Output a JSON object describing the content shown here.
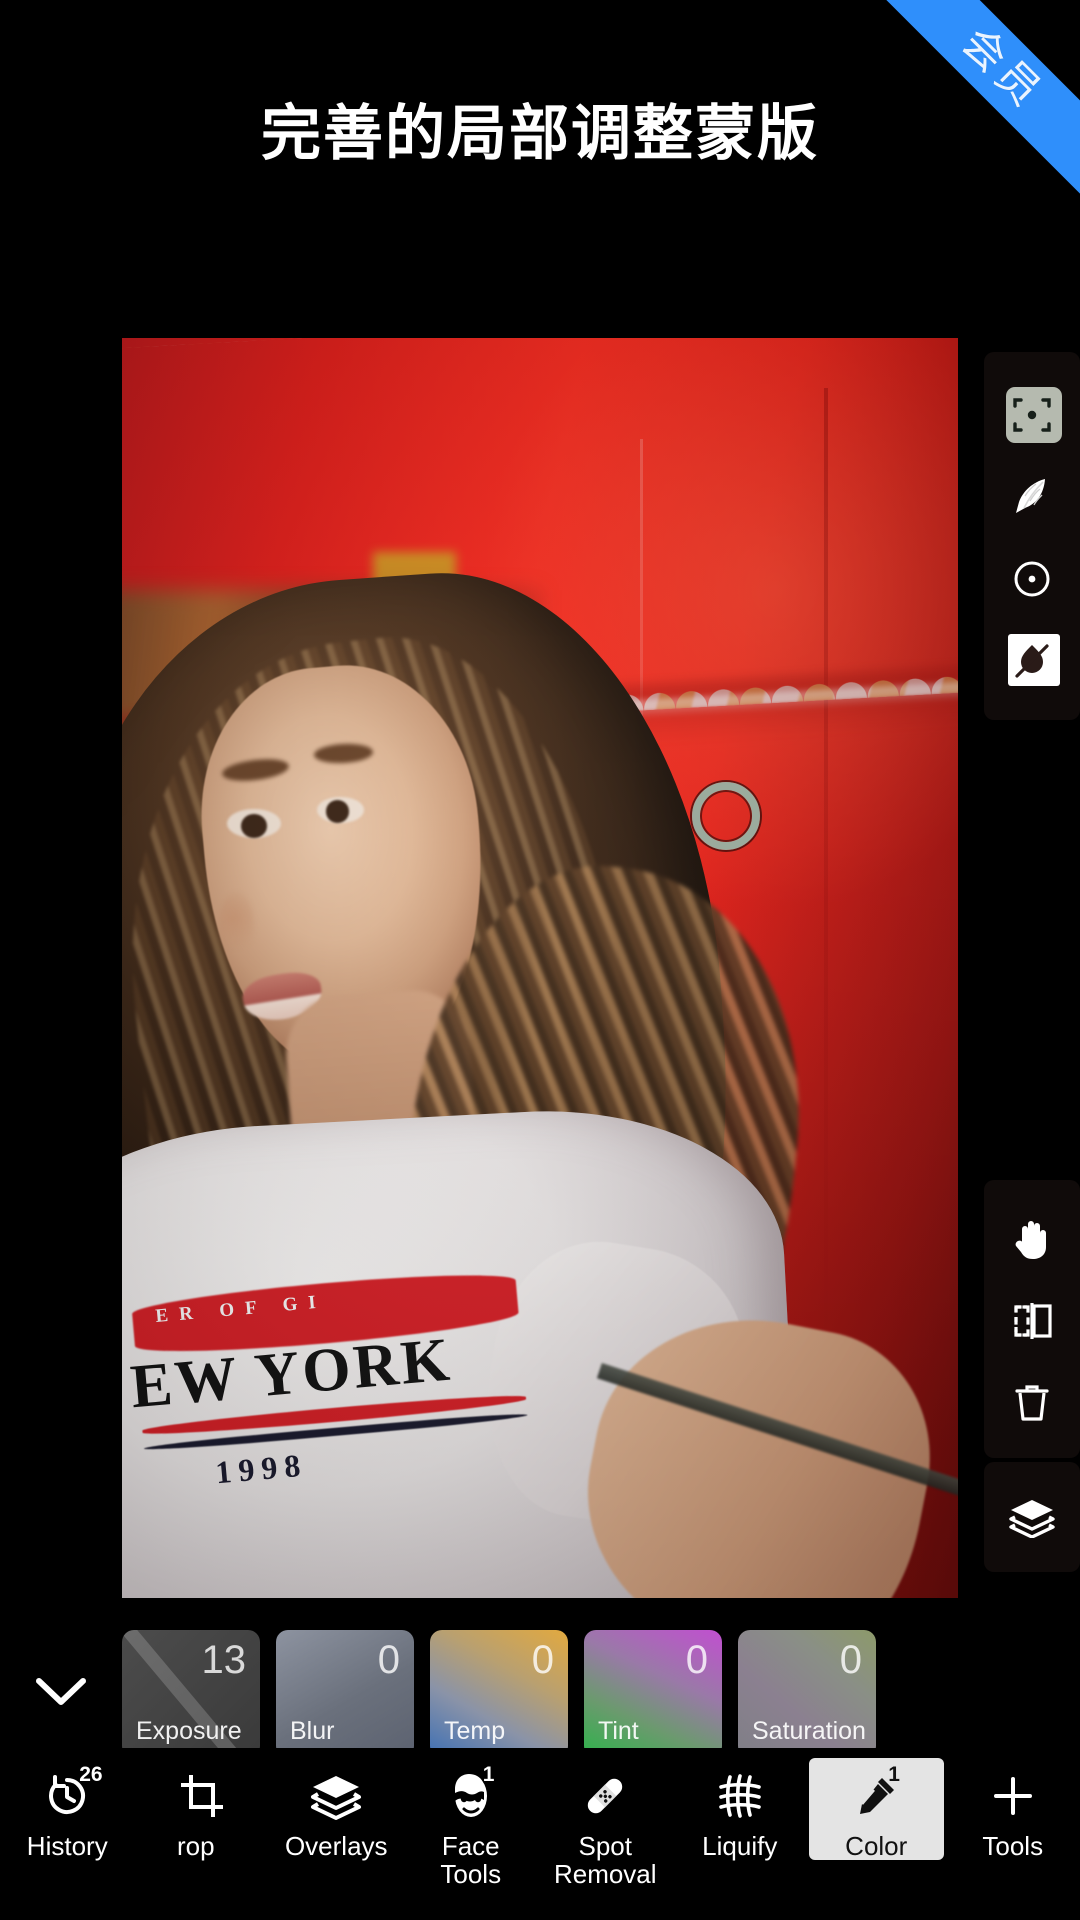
{
  "ribbon": {
    "label": "会员"
  },
  "headline": {
    "title": "完善的局部调整蒙版"
  },
  "photo": {
    "tee_line_small": "ER OF GI",
    "tee_line_big": "EW YORK",
    "tee_year": "1998"
  },
  "marker": {
    "name": "selective-adjust-point",
    "color": "#9bab9d"
  },
  "panels": {
    "top": {
      "items": [
        {
          "icon": "selective-target-icon",
          "label": "Selective",
          "selected": true
        },
        {
          "icon": "feather-icon",
          "label": "Feather",
          "selected": false
        },
        {
          "icon": "brush-size-icon",
          "label": "Size",
          "selected": false
        },
        {
          "icon": "invert-mask-icon",
          "label": "Invert",
          "selected": true
        }
      ]
    },
    "mid": {
      "items": [
        {
          "icon": "hand-pan-icon",
          "label": "Pan",
          "selected": false
        },
        {
          "icon": "flip-mask-icon",
          "label": "Flip",
          "selected": false
        },
        {
          "icon": "trash-icon",
          "label": "Delete",
          "selected": false
        }
      ]
    },
    "low": {
      "items": [
        {
          "icon": "layers-icon",
          "label": "Layers",
          "selected": false
        }
      ]
    }
  },
  "adjustments": {
    "collapse_icon": "chevron-down-icon",
    "tiles": [
      {
        "label": "Exposure",
        "value": "13",
        "key": "exposure"
      },
      {
        "label": "Blur",
        "value": "0",
        "key": "blur"
      },
      {
        "label": "Temp",
        "value": "0",
        "key": "temp"
      },
      {
        "label": "Tint",
        "value": "0",
        "key": "tint"
      },
      {
        "label": "Saturation",
        "value": "0",
        "key": "saturation"
      }
    ]
  },
  "bottom_nav": {
    "items": [
      {
        "label": "History",
        "icon": "history-icon",
        "badge": "26",
        "selected": false,
        "clipped": false
      },
      {
        "label": "rop",
        "icon": "crop-icon",
        "badge": "",
        "selected": false,
        "clipped": true
      },
      {
        "label": "Overlays",
        "icon": "overlays-icon",
        "badge": "",
        "selected": false,
        "clipped": false
      },
      {
        "label": "Face\nTools",
        "icon": "face-tools-icon",
        "badge": "1",
        "selected": false,
        "clipped": false
      },
      {
        "label": "Spot\nRemoval",
        "icon": "spot-removal-icon",
        "badge": "",
        "selected": false,
        "clipped": false
      },
      {
        "label": "Liquify",
        "icon": "liquify-icon",
        "badge": "",
        "selected": false,
        "clipped": false
      },
      {
        "label": "Color",
        "icon": "color-icon",
        "badge": "1",
        "selected": true,
        "clipped": false
      },
      {
        "label": "Tools",
        "icon": "tools-plus-icon",
        "badge": "",
        "selected": false,
        "clipped": false
      }
    ]
  },
  "colors": {
    "ribbon_bg": "#2f8ffb",
    "app_bg": "#000000",
    "selected_nav_bg": "#e4e4e4",
    "marker_ring": "#9bab9d",
    "wall_red": "#f02018",
    "awning_orange": "#eeb25e"
  }
}
